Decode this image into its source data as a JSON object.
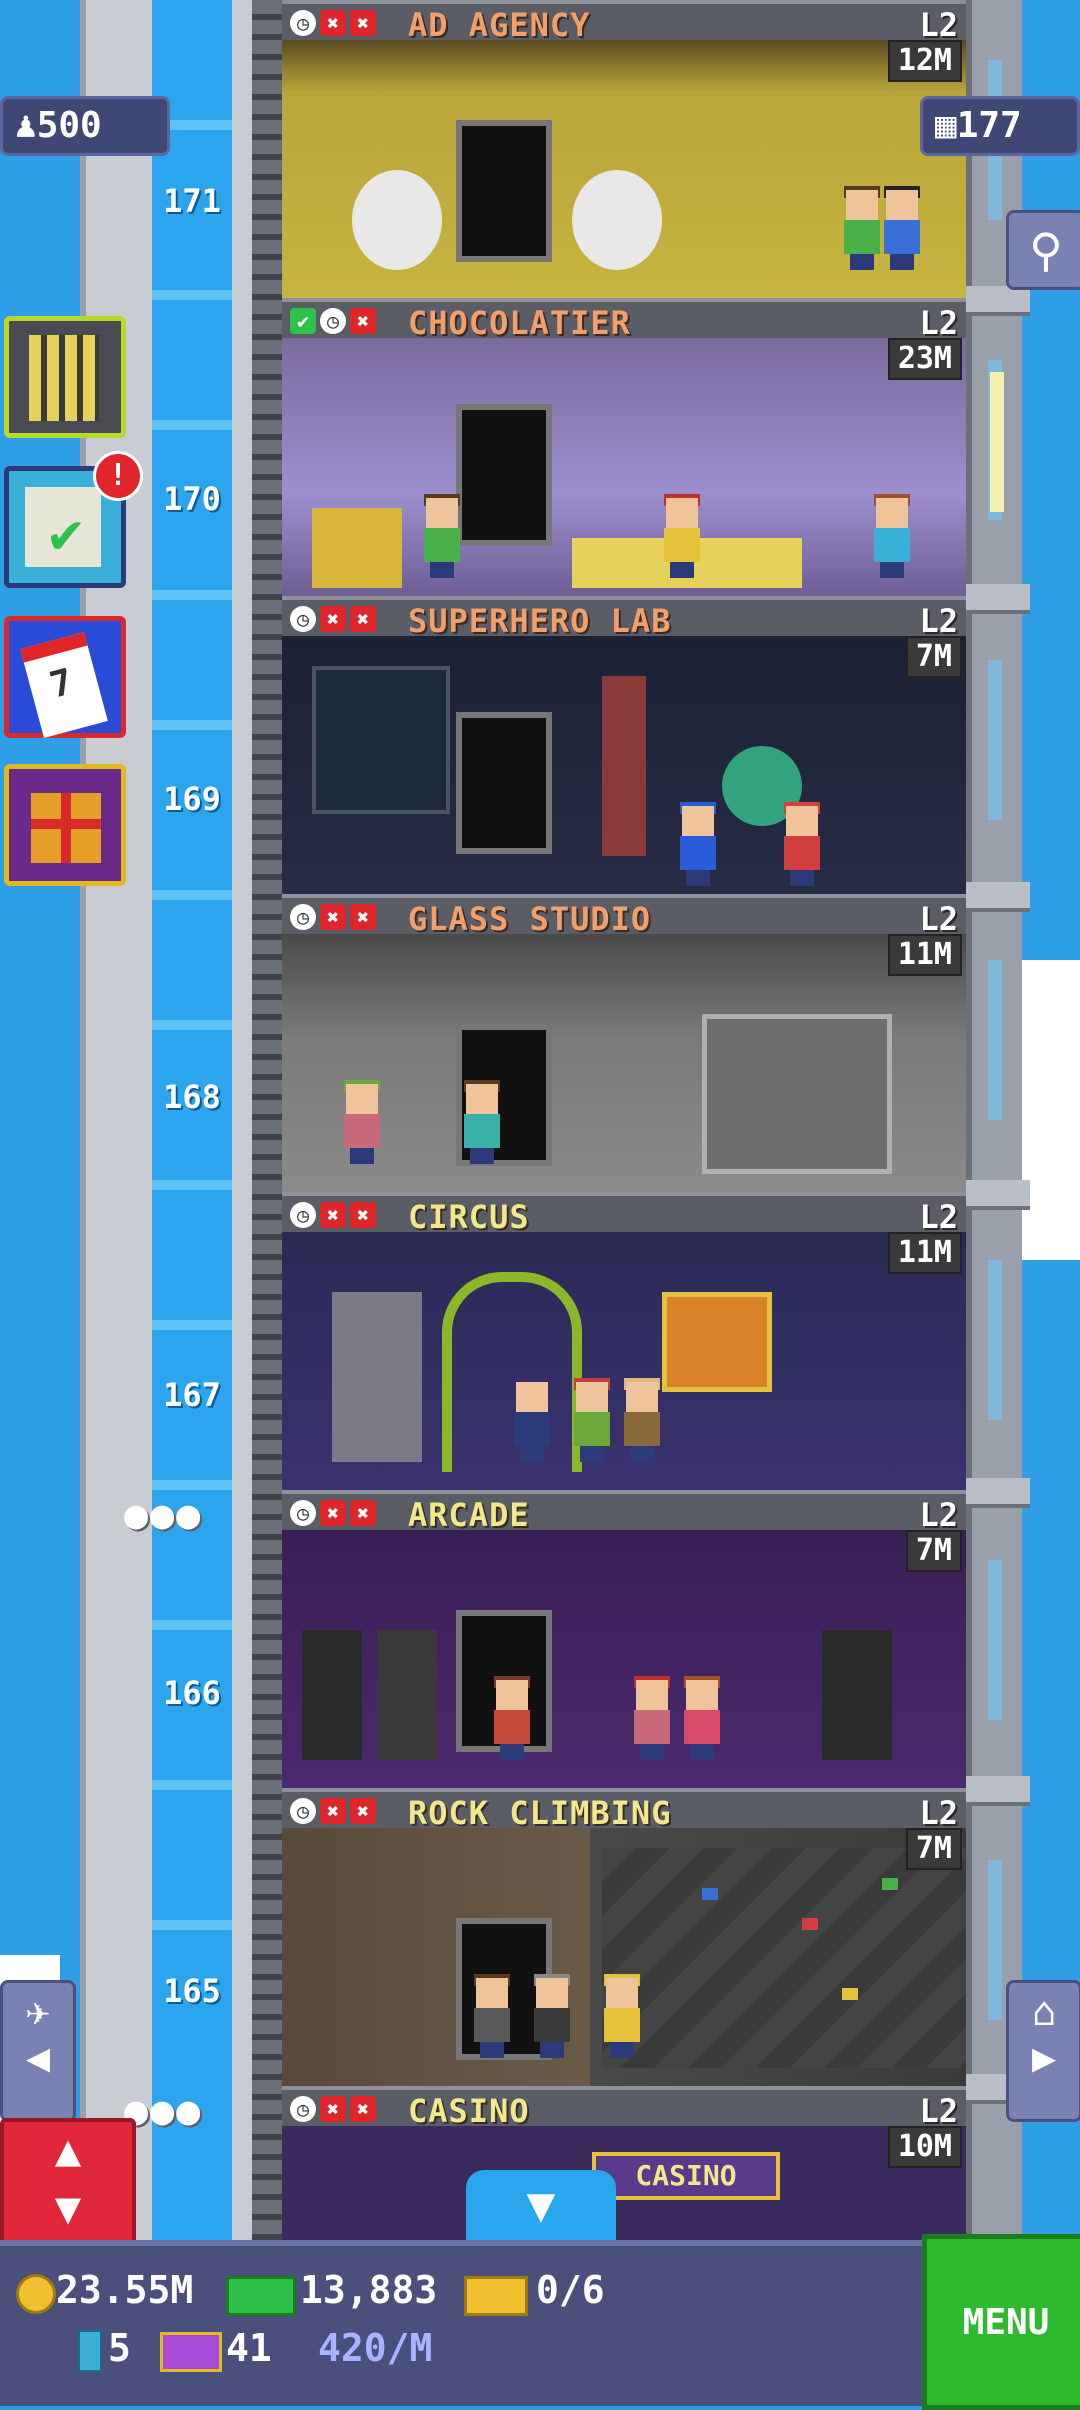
{
  "hud": {
    "population": "500",
    "floors_count": "177",
    "coins": "23.55M",
    "bux": "13,883",
    "tickets": "0/6",
    "keys": "5",
    "vip": "41",
    "rate": "420/M",
    "menu_label": "MENU"
  },
  "floor_numbers": [
    "171",
    "170",
    "169",
    "168",
    "167",
    "166",
    "165"
  ],
  "floors": [
    {
      "name": "AD AGENCY",
      "level": "L2",
      "income": "12M",
      "status": [
        "clock",
        "x",
        "x"
      ]
    },
    {
      "name": "CHOCOLATIER",
      "level": "L2",
      "income": "23M",
      "status": [
        "check",
        "clock",
        "x"
      ]
    },
    {
      "name": "SUPERHERO LAB",
      "level": "L2",
      "income": "7M",
      "status": [
        "clock",
        "x",
        "x"
      ]
    },
    {
      "name": "GLASS STUDIO",
      "level": "L2",
      "income": "11M",
      "status": [
        "clock",
        "x",
        "x"
      ]
    },
    {
      "name": "CIRCUS",
      "level": "L2",
      "income": "11M",
      "status": [
        "clock",
        "x",
        "x"
      ]
    },
    {
      "name": "ARCADE",
      "level": "L2",
      "income": "7M",
      "status": [
        "clock",
        "x",
        "x"
      ]
    },
    {
      "name": "ROCK CLIMBING",
      "level": "L2",
      "income": "7M",
      "status": [
        "clock",
        "x",
        "x"
      ]
    },
    {
      "name": "CASINO",
      "level": "L2",
      "income": "10M",
      "status": [
        "clock",
        "x",
        "x"
      ]
    }
  ],
  "sign_casino": "CASINO",
  "mission_badge": "!",
  "calendar_day": "7",
  "icons": {
    "population": "person-icon",
    "floors": "building-grid-icon",
    "search": "magnifier-icon",
    "coins": "coin-icon",
    "bux": "banknote-icon",
    "tickets": "ticket-icon",
    "keys": "key-icon",
    "vip": "vip-icon"
  },
  "colors": {
    "sky": "#2e9ee6",
    "menu": "#2fb92e",
    "elevator_button": "#e0283a",
    "hud_bar": "#4a4f7c"
  }
}
